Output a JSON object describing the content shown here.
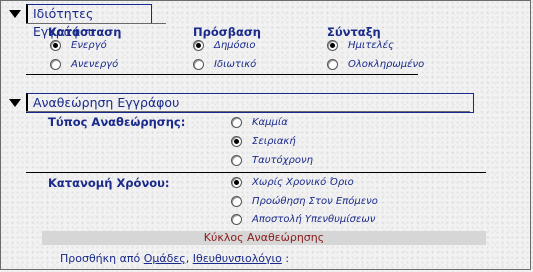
{
  "section1": {
    "title": "Ιδιότητες Εγγράφου",
    "columns": [
      {
        "label": "Κατάσταση",
        "options": [
          {
            "label": "Ενεργό",
            "selected": true
          },
          {
            "label": "Ανενεργό",
            "selected": false
          }
        ]
      },
      {
        "label": "Πρόσβαση",
        "options": [
          {
            "label": "Δημόσιο",
            "selected": true
          },
          {
            "label": "Ιδιωτικό",
            "selected": false
          }
        ]
      },
      {
        "label": "Σύνταξη",
        "options": [
          {
            "label": "Ημιτελές",
            "selected": true
          },
          {
            "label": "Ολοκληρωμένο",
            "selected": false
          }
        ]
      }
    ]
  },
  "section2": {
    "title": "Αναθεώρηση Εγγράφου",
    "revision_type": {
      "label": "Τύπος Αναθεώρησης:",
      "options": [
        {
          "label": "Καμμία",
          "selected": false
        },
        {
          "label": "Σειριακή",
          "selected": true
        },
        {
          "label": "Ταυτόχρονη",
          "selected": false
        }
      ]
    },
    "time_allocation": {
      "label": "Κατανομή Χρόνου:",
      "options": [
        {
          "label": "Χωρίς Χρονικό Όριο",
          "selected": true
        },
        {
          "label": "Προώθηση Στον Επόμενο",
          "selected": false
        },
        {
          "label": "Αποστολή Υπενθυμίσεων",
          "selected": false
        }
      ]
    },
    "cycle_title": "Κύκλος Αναθεώρησης",
    "add_prefix": "Προσθήκη από",
    "groups_link": "Ομάδες",
    "separator": ",",
    "directory_link": "Ιθευθυνσιολόγιο",
    "add_suffix": ":"
  }
}
